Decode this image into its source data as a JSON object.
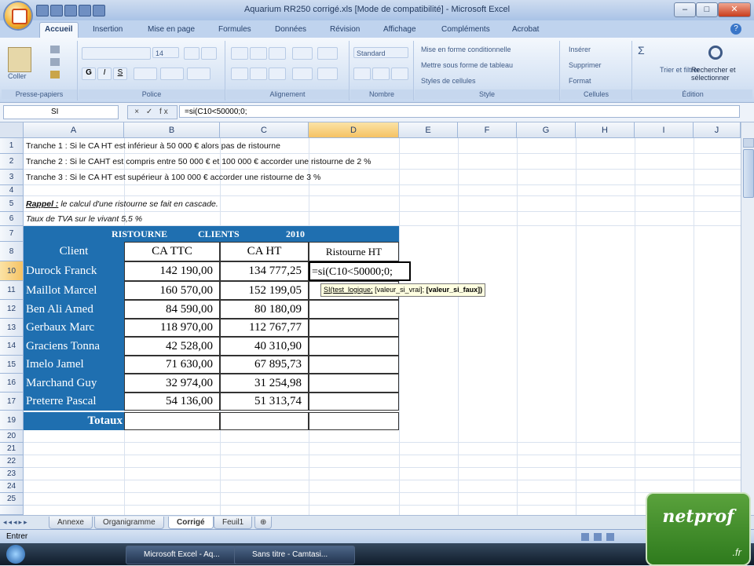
{
  "window": {
    "title": "Aquarium RR250 corrigé.xls  [Mode de compatibilité] - Microsoft Excel",
    "minimize": "–",
    "maximize": "□",
    "close": "✕"
  },
  "ribbon": {
    "tabs": [
      "Accueil",
      "Insertion",
      "Mise en page",
      "Formules",
      "Données",
      "Révision",
      "Affichage",
      "Compléments",
      "Acrobat"
    ],
    "active_tab": "Accueil",
    "groups": [
      "Presse-papiers",
      "Police",
      "Alignement",
      "Nombre",
      "Style",
      "Cellules",
      "Édition"
    ],
    "paste_label": "Coller",
    "font_size": "14",
    "number_format": "Standard",
    "style_items": [
      "Mise en forme conditionnelle",
      "Mettre sous forme de tableau",
      "Styles de cellules"
    ],
    "cell_items": [
      "Insérer",
      "Supprimer",
      "Format"
    ],
    "edit_items": [
      "Trier et filtrer",
      "Rechercher et sélectionner"
    ]
  },
  "formula_bar": {
    "name_box": "SI",
    "fx_buttons": "× ✓ fx",
    "formula": "=si(C10<50000;0;"
  },
  "columns": [
    "A",
    "B",
    "C",
    "D",
    "E",
    "F",
    "G",
    "H",
    "I",
    "J"
  ],
  "rows": [
    "1",
    "2",
    "3",
    "4",
    "5",
    "6",
    "7",
    "8",
    "10",
    "11",
    "12",
    "13",
    "14",
    "15",
    "16",
    "17",
    "19",
    "20",
    "21",
    "22",
    "23",
    "24",
    "25"
  ],
  "notes": {
    "row1": "Tranche 1 : Si le CA HT est inférieur à 50 000 € alors pas de ristourne",
    "row2": "Tranche 2 : Si le CAHT est compris entre 50 000 € et 100 000 € accorder une ristourne de 2 %",
    "row3": "Tranche 3 : Si le CA HT est supérieur à 100 000 € accorder une ristourne de 3 %",
    "rappel_label": "Rappel :",
    "rappel_text": "le calcul d'une ristourne se fait en cascade.",
    "tva": "Taux de TVA sur le vivant 5,5 %"
  },
  "table": {
    "title_parts": [
      "RISTOURNE",
      "CLIENTS",
      "2010"
    ],
    "headers": [
      "Client",
      "CA TTC",
      "CA HT",
      "Ristourne HT"
    ],
    "rows": [
      {
        "client": "Durock Franck",
        "ttc": "142 190,00",
        "ht": "134 777,25"
      },
      {
        "client": "Maillot Marcel",
        "ttc": "160 570,00",
        "ht": "152 199,05"
      },
      {
        "client": "Ben Ali  Amed",
        "ttc": "84 590,00",
        "ht": "80 180,09"
      },
      {
        "client": "Gerbaux Marc",
        "ttc": "118 970,00",
        "ht": "112 767,77"
      },
      {
        "client": "Graciens Tonna",
        "ttc": "42 528,00",
        "ht": "40 310,90"
      },
      {
        "client": "Imelo Jamel",
        "ttc": "71 630,00",
        "ht": "67 895,73"
      },
      {
        "client": "Marchand Guy",
        "ttc": "32 974,00",
        "ht": "31 254,98"
      },
      {
        "client": "Preterre Pascal",
        "ttc": "54 136,00",
        "ht": "51 313,74"
      }
    ],
    "editing_cell": "=si(C10<50000;0;",
    "totals_label": "Totaux"
  },
  "tooltip": {
    "arg1": "SI(test_logique;",
    "arg2": "[valeur_si_vrai];",
    "arg3": "[valeur_si_faux])"
  },
  "sheet_tabs": [
    "Annexe",
    "Organigramme",
    "Corrigé",
    "Feuil1"
  ],
  "active_sheet": "Corrigé",
  "status": "Entrer",
  "taskbar": {
    "items": [
      "Microsoft Excel - Aq...",
      "Sans titre - Camtasi..."
    ]
  },
  "logo": {
    "text": "netprof",
    "suffix": ".fr"
  },
  "colors": {
    "accent_blue": "#1f6fb0",
    "selection": "#f5c264"
  }
}
